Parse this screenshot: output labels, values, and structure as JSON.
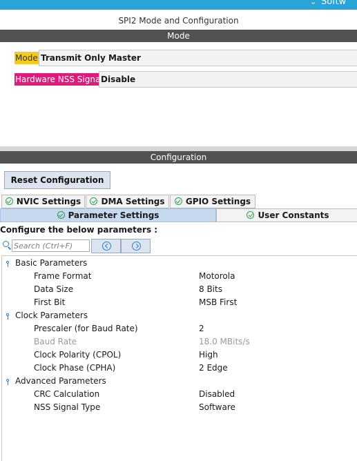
{
  "header": {
    "software_label": "Softw",
    "panel_title": "SPI2 Mode and Configuration"
  },
  "mode_section": {
    "title": "Mode",
    "fields": [
      {
        "label": "Mode",
        "value": "Transmit Only Master",
        "label_color": "#f5cc1e"
      },
      {
        "label": "Hardware NSS Signal",
        "value": "Disable",
        "label_color": "#e0197a"
      }
    ]
  },
  "config_section": {
    "title": "Configuration",
    "reset_button": "Reset Configuration",
    "tabs": [
      {
        "label": "NVIC Settings",
        "selected": false
      },
      {
        "label": "DMA Settings",
        "selected": false
      },
      {
        "label": "GPIO Settings",
        "selected": false
      },
      {
        "label": "Parameter Settings",
        "selected": true
      },
      {
        "label": "User Constants",
        "selected": false
      }
    ],
    "configure_label": "Configure the below parameters :",
    "search": {
      "placeholder": "Search (Ctrl+F)",
      "value": ""
    },
    "groups": [
      {
        "name": "Basic Parameters",
        "params": [
          {
            "name": "Frame Format",
            "value": "Motorola"
          },
          {
            "name": "Data Size",
            "value": "8 Bits"
          },
          {
            "name": "First Bit",
            "value": "MSB First"
          }
        ]
      },
      {
        "name": "Clock Parameters",
        "params": [
          {
            "name": "Prescaler (for Baud Rate)",
            "value": "2"
          },
          {
            "name": "Baud Rate",
            "value": "18.0 MBits/s",
            "disabled": true
          },
          {
            "name": "Clock Polarity (CPOL)",
            "value": "High"
          },
          {
            "name": "Clock Phase (CPHA)",
            "value": "2 Edge"
          }
        ]
      },
      {
        "name": "Advanced Parameters",
        "params": [
          {
            "name": "CRC Calculation",
            "value": "Disabled"
          },
          {
            "name": "NSS Signal Type",
            "value": "Software"
          }
        ]
      }
    ]
  },
  "colors": {
    "section_bar": "#525252",
    "top_strip": "#2aa3d9",
    "selected_tab": "#c7d9ef",
    "check_icon": "#2e9e4b",
    "accent_icon": "#2a7fc7"
  }
}
